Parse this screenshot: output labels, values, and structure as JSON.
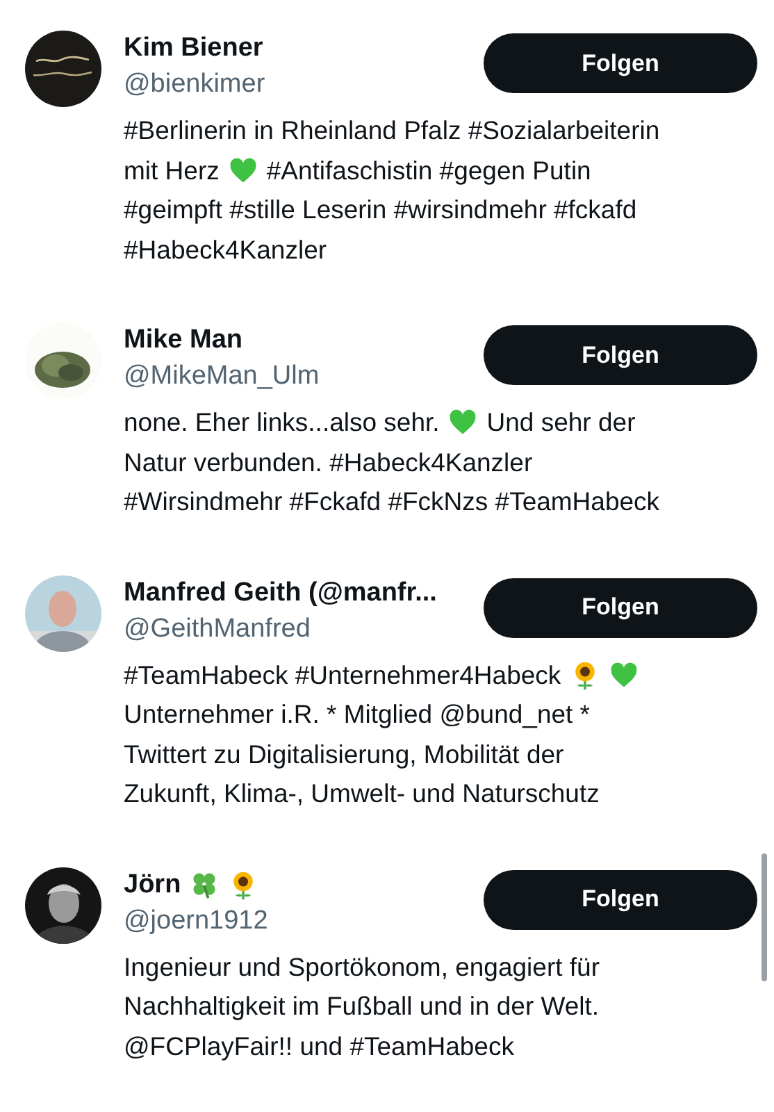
{
  "accounts": [
    {
      "name": [
        {
          "kind": "text",
          "text": "Kim Biener"
        }
      ],
      "handle": "@bienkimer",
      "avatar": {
        "kind": "picture"
      },
      "button": "Folgen",
      "bio_lines": [
        [
          {
            "kind": "text",
            "text": "#Berlinerin in Rheinland Pfalz #Sozialarbeiterin"
          }
        ],
        [
          {
            "kind": "text",
            "text": "mit Herz"
          },
          {
            "kind": "heart"
          },
          {
            "kind": "text",
            "text": "#Antifaschistin #gegen Putin"
          }
        ],
        [
          {
            "kind": "text",
            "text": "#geimpft #stille Leserin #wirsindmehr #fckafd"
          }
        ],
        [
          {
            "kind": "text",
            "text": "#Habeck4Kanzler"
          }
        ]
      ]
    },
    {
      "name": [
        {
          "kind": "text",
          "text": "Mike Man"
        }
      ],
      "handle": "@MikeMan_Ulm",
      "avatar": {
        "kind": "picture"
      },
      "button": "Folgen",
      "bio_lines": [
        [
          {
            "kind": "text",
            "text": "none. Eher links...also sehr."
          },
          {
            "kind": "heart"
          },
          {
            "kind": "text",
            "text": "Und sehr der"
          }
        ],
        [
          {
            "kind": "text",
            "text": "Natur verbunden. #Habeck4Kanzler"
          }
        ],
        [
          {
            "kind": "text",
            "text": "#Wirsindmehr #Fckafd #FckNzs #TeamHabeck"
          }
        ]
      ]
    },
    {
      "name": [
        {
          "kind": "text",
          "text": "Manfred Geith (@manfr..."
        }
      ],
      "handle": "@GeithManfred",
      "avatar": {
        "kind": "picture"
      },
      "button": "Folgen",
      "bio_lines": [
        [
          {
            "kind": "text",
            "text": "#TeamHabeck #Unternehmer4Habeck"
          },
          {
            "kind": "sunflower"
          },
          {
            "kind": "heart"
          }
        ],
        [
          {
            "kind": "text",
            "text": "Unternehmer i.R. * Mitglied @bund_net *"
          }
        ],
        [
          {
            "kind": "text",
            "text": "Twittert zu Digitalisierung, Mobilität der"
          }
        ],
        [
          {
            "kind": "text",
            "text": "Zukunft, Klima-, Umwelt- und Naturschutz"
          }
        ]
      ]
    },
    {
      "name": [
        {
          "kind": "text",
          "text": "Jörn"
        },
        {
          "kind": "clover"
        },
        {
          "kind": "sunflower"
        }
      ],
      "handle": "@joern1912",
      "avatar": {
        "kind": "picture"
      },
      "button": "Folgen",
      "bio_lines": [
        [
          {
            "kind": "text",
            "text": "Ingenieur und Sportökonom, engagiert für"
          }
        ],
        [
          {
            "kind": "text",
            "text": "Nachhaltigkeit im Fußball und in der Welt."
          }
        ],
        [
          {
            "kind": "text",
            "text": "@FCPlayFair!! und #TeamHabeck"
          }
        ]
      ]
    }
  ]
}
